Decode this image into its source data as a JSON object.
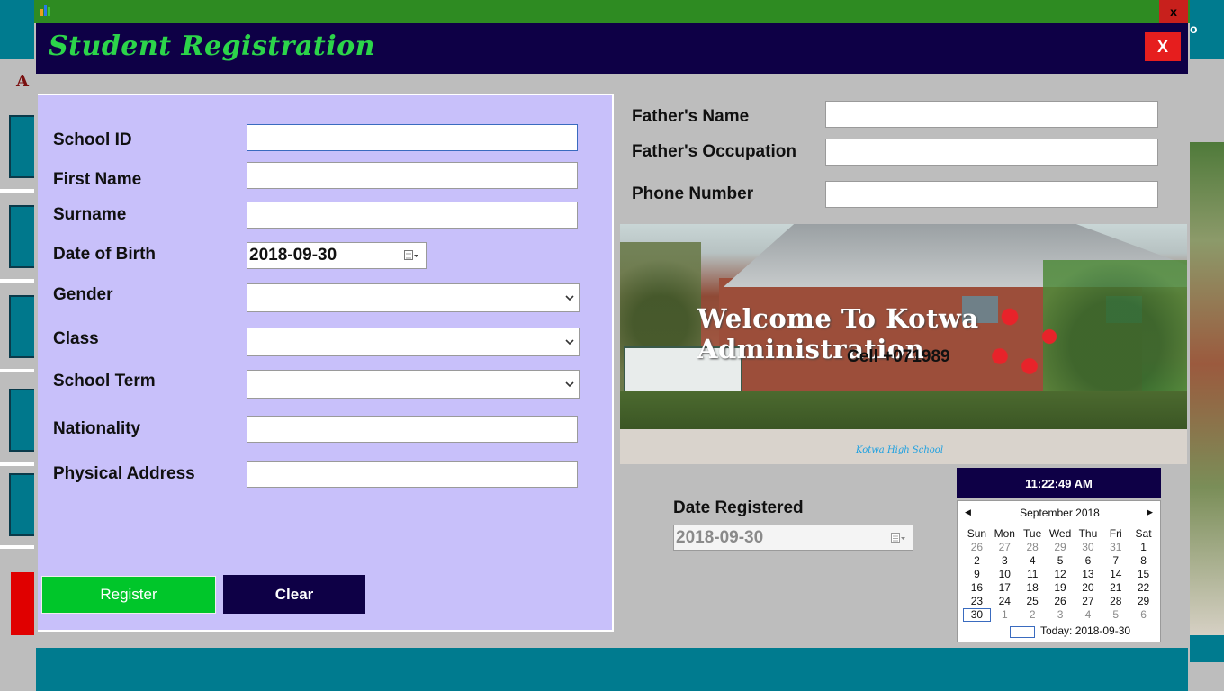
{
  "window": {
    "title_close": "x"
  },
  "background": {
    "left_mark": "A",
    "right_text": "o"
  },
  "header": {
    "title": "Student Registration",
    "close_label": "X"
  },
  "form": {
    "school_id_label": "School ID",
    "first_name_label": "First Name",
    "surname_label": "Surname",
    "dob_label": "Date of Birth",
    "dob_value": "2018-09-30",
    "gender_label": "Gender",
    "class_label": "Class",
    "school_term_label": "School Term",
    "nationality_label": "Nationality",
    "physical_address_label": "Physical Address",
    "register_label": "Register",
    "clear_label": "Clear"
  },
  "parent": {
    "father_name_label": "Father's Name",
    "father_occupation_label": "Father's Occupation",
    "phone_number_label": "Phone Number"
  },
  "banner": {
    "welcome": "Welcome To Kotwa Administration",
    "cell": "Cell +071989",
    "caption": "Kotwa High School"
  },
  "registration": {
    "date_registered_label": "Date Registered",
    "date_registered_value": "2018-09-30"
  },
  "clock": {
    "time": "11:22:49 AM"
  },
  "calendar": {
    "month": "September 2018",
    "weekdays": [
      "Sun",
      "Mon",
      "Tue",
      "Wed",
      "Thu",
      "Fri",
      "Sat"
    ],
    "weeks": [
      [
        "26",
        "27",
        "28",
        "29",
        "30",
        "31",
        "1"
      ],
      [
        "2",
        "3",
        "4",
        "5",
        "6",
        "7",
        "8"
      ],
      [
        "9",
        "10",
        "11",
        "12",
        "13",
        "14",
        "15"
      ],
      [
        "16",
        "17",
        "18",
        "19",
        "20",
        "21",
        "22"
      ],
      [
        "23",
        "24",
        "25",
        "26",
        "27",
        "28",
        "29"
      ],
      [
        "30",
        "1",
        "2",
        "3",
        "4",
        "5",
        "6"
      ]
    ],
    "selected": "30",
    "today_label": "Today: 2018-09-30"
  },
  "colors": {
    "header_bg": "#0e0046",
    "title_green": "#2cd44a",
    "form_bg": "#c8c0fa",
    "register_bg": "#00c62a",
    "titlebar": "#2e8b22",
    "close_red": "#e61e1e"
  }
}
